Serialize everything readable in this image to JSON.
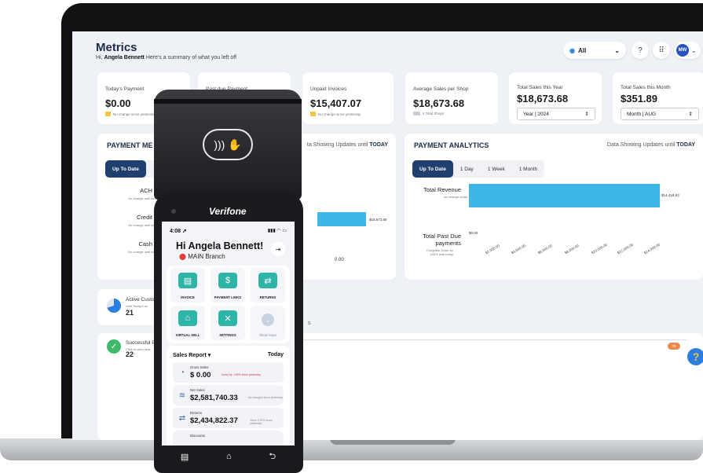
{
  "dashboard": {
    "title": "Metrics",
    "greeting_prefix": "Hi,",
    "user_name": "Angela Bennett",
    "greeting_suffix": "Here's a summary of what you left off",
    "location_filter": "All",
    "help_glyph": "?",
    "apps_glyph": "⠿",
    "avatar_initials": "MW"
  },
  "stat_cards": [
    {
      "label": "Today's Payment",
      "value": "$0.00",
      "sub": "No change since yesterday"
    },
    {
      "label": "Past due Payment",
      "value": "",
      "sub": ""
    },
    {
      "label": "Unpaid Invoices",
      "value": "$15,407.07",
      "sub": "No change since yesterday"
    },
    {
      "label": "Average Sales per Shop",
      "value": "$18,673.68",
      "sub": "4 Total Shops"
    },
    {
      "label": "Total Sales this Year",
      "value": "$18,673.68",
      "select": "Year | 2024"
    },
    {
      "label": "Total Sales this Month",
      "value": "$351.89",
      "select": "Month | AUG"
    }
  ],
  "payment_methods": {
    "title": "PAYMENT ME",
    "right_fragment": "ta Showing Updates until",
    "right_bold": "TODAY",
    "active_tab": "Up To Date",
    "rows": [
      {
        "label": "ACH",
        "sub": "No change until today"
      },
      {
        "label": "Credit",
        "sub": "No change until today"
      },
      {
        "label": "Cash",
        "sub": "No change until today"
      }
    ],
    "bar_value": "$18,673.68",
    "axis_fragment": "0.00"
  },
  "payment_analytics": {
    "title": "PAYMENT ANALYTICS",
    "right_text": "Data Showing Updates until",
    "right_bold": "TODAY",
    "tabs": [
      "Up To Date",
      "1 Day",
      "1 Week",
      "1 Month"
    ],
    "row1_label": "Total Revenue",
    "row1_sub": "No change today",
    "row2_label_1": "Total Past Due",
    "row2_label_2": "payments",
    "row2_sub_1": "Congrats! Down by",
    "row2_sub_2": "100% until today",
    "row2_value": "$0.00"
  },
  "chart_data": {
    "type": "bar",
    "orientation": "horizontal",
    "categories": [
      "Total Revenue",
      "Total Past Due payments"
    ],
    "values": [
      14418.63,
      0
    ],
    "value_labels": [
      "$14,418.63",
      "$0.00"
    ],
    "xlim": [
      0,
      14000
    ],
    "x_ticks": [
      "$0.00",
      "$2,000.00",
      "$4,000.00",
      "$6,000.00",
      "$8,000.00",
      "$10,000.00",
      "$12,000.00",
      "$14,000.00"
    ]
  },
  "activity": {
    "active_label": "Active Custo",
    "active_sub_1": "Until Today's ac",
    "active_count": "21",
    "success_label": "Successful P",
    "success_sub": "Click to view deta",
    "success_count": "22",
    "badge": "76",
    "tab_fragment": "s"
  },
  "terminal": {
    "brand": "Verifone",
    "time": "4:08",
    "status_icons": "▮▮▮ ◠ ▭",
    "greeting": "Hi Angela Bennett!",
    "branch": "MAIN Branch",
    "tiles": [
      {
        "label": "INVOICE",
        "icon": "invoice-icon",
        "glyph": "▤"
      },
      {
        "label": "PAYMENT LINKS",
        "icon": "payment-link-icon",
        "glyph": "$"
      },
      {
        "label": "RETURNS",
        "icon": "returns-icon",
        "glyph": "⇄"
      },
      {
        "label": "VIRTUAL SELL",
        "icon": "basket-icon",
        "glyph": "⌂"
      },
      {
        "label": "SETTINGS",
        "icon": "settings-tools-icon",
        "glyph": "✕"
      },
      {
        "label": "Show more",
        "icon": "chevron-down-icon",
        "glyph": "⌄"
      }
    ],
    "sales_report": "Sales Report",
    "sales_period": "Today",
    "rows": [
      {
        "label": "Gross Sales",
        "value": "$ 0.00",
        "note": "Down by -100% since yesterday"
      },
      {
        "label": "Net Sales",
        "value": "$2,581,740.33",
        "note": "No changes since yesterday"
      },
      {
        "label": "Returns",
        "value": "$2,434,822.37",
        "note": "Value 3,00% since yesterday"
      },
      {
        "label": "Discounts",
        "value": "",
        "note": ""
      }
    ]
  },
  "colors": {
    "accent": "#1f3f6e",
    "bar": "#3eb6e6",
    "teal": "#2fb4a8",
    "success": "#3fb86b"
  }
}
